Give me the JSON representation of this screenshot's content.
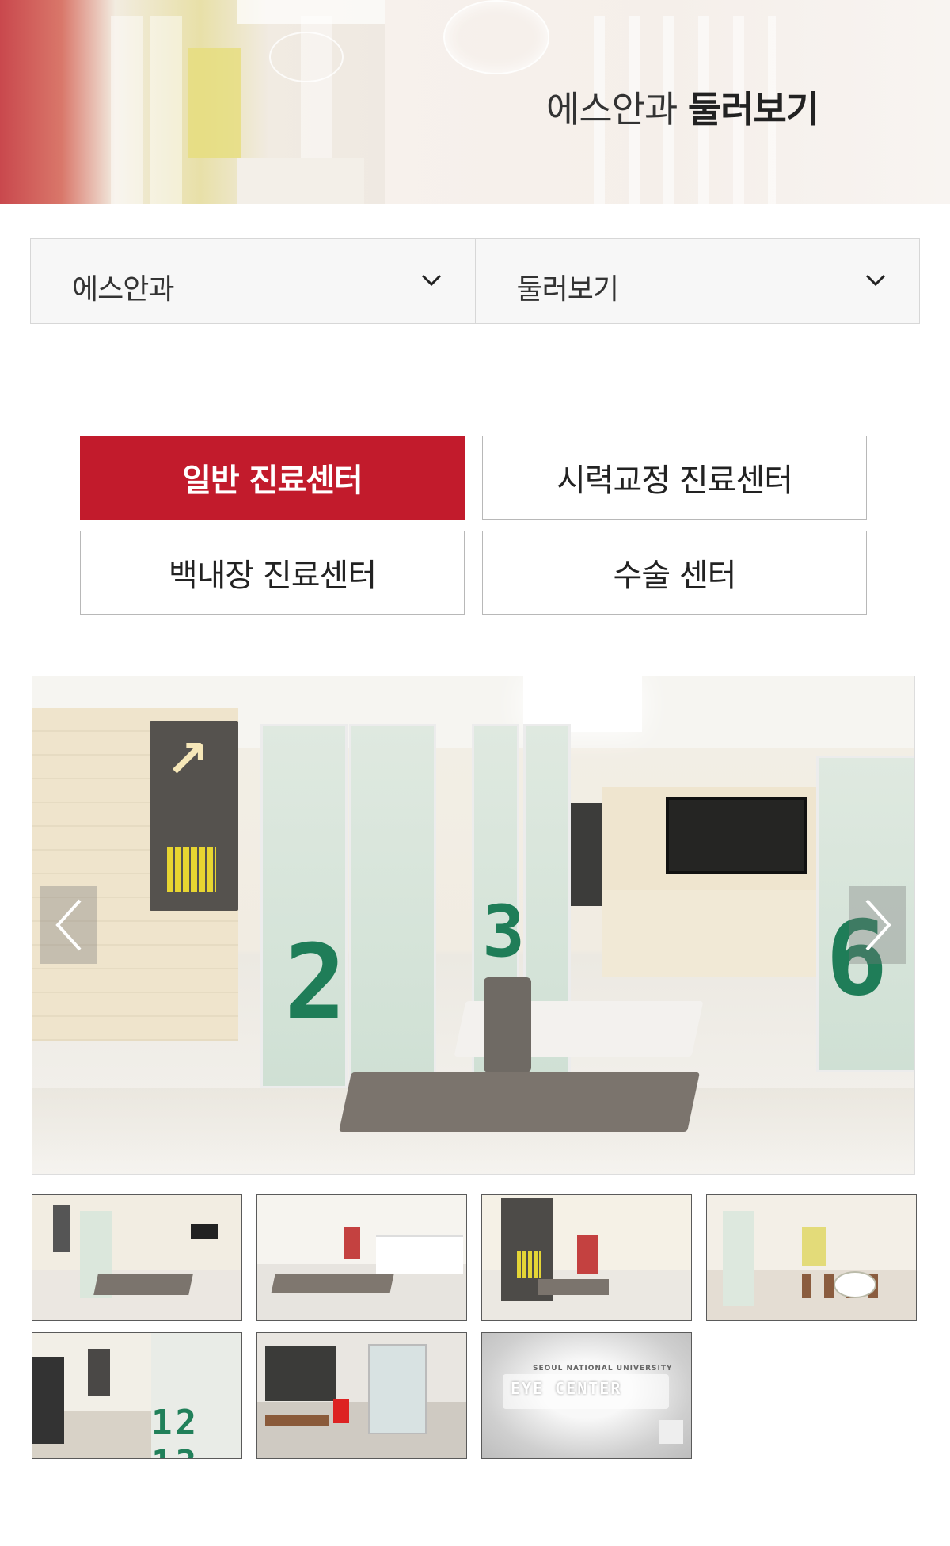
{
  "hero": {
    "title_normal": "에스안과",
    "title_bold": "둘러보기"
  },
  "selectors": [
    {
      "value": "에스안과",
      "icon": "chevron-down-icon"
    },
    {
      "value": "둘러보기",
      "icon": "chevron-down-icon"
    }
  ],
  "tabs": [
    {
      "label": "일반 진료센터",
      "active": true
    },
    {
      "label": "시력교정 진료센터",
      "active": false
    },
    {
      "label": "백내장 진료센터",
      "active": false
    },
    {
      "label": "수술 센터",
      "active": false
    }
  ],
  "colors": {
    "accent": "#c21b2c",
    "border": "#b8b8b8",
    "select_bg": "#f7f7f7"
  },
  "gallery": {
    "prev_icon": "chevron-left-icon",
    "next_icon": "chevron-right-icon",
    "thumbnail_count": 7,
    "thumb7_text": "EYE CENTER",
    "thumb7_subtext": "SEOUL NATIONAL UNIVERSITY"
  }
}
